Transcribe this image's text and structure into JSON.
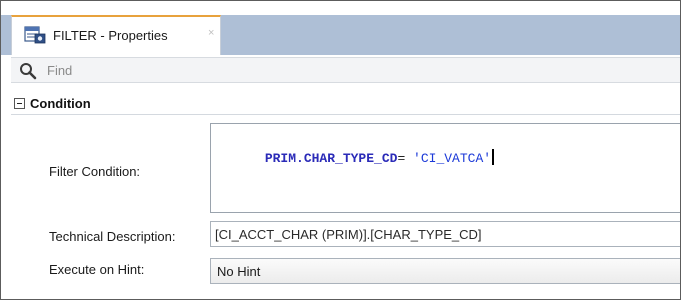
{
  "tab": {
    "title": "FILTER - Properties",
    "close_glyph": "×",
    "icon": "properties-sheet-icon"
  },
  "find": {
    "placeholder": "Find",
    "icon": "search-icon"
  },
  "section": {
    "title": "Condition",
    "icon": "collapse-minus-icon"
  },
  "fields": {
    "filter_condition": {
      "label": "Filter Condition:",
      "code_identifier": "PRIM.CHAR_TYPE_CD",
      "code_operator": "= ",
      "code_string": "'CI_VATCA'"
    },
    "technical_description": {
      "label": "Technical Description:",
      "value": "[CI_ACCT_CHAR (PRIM)].[CHAR_TYPE_CD]"
    },
    "execute_on_hint": {
      "label": "Execute on Hint:",
      "selected": "No Hint"
    }
  },
  "colors": {
    "tabstrip": "#aebfd6",
    "tab_accent": "#e8a23c",
    "code_identifier": "#2b2bb8",
    "code_string": "#1c3ad8"
  }
}
